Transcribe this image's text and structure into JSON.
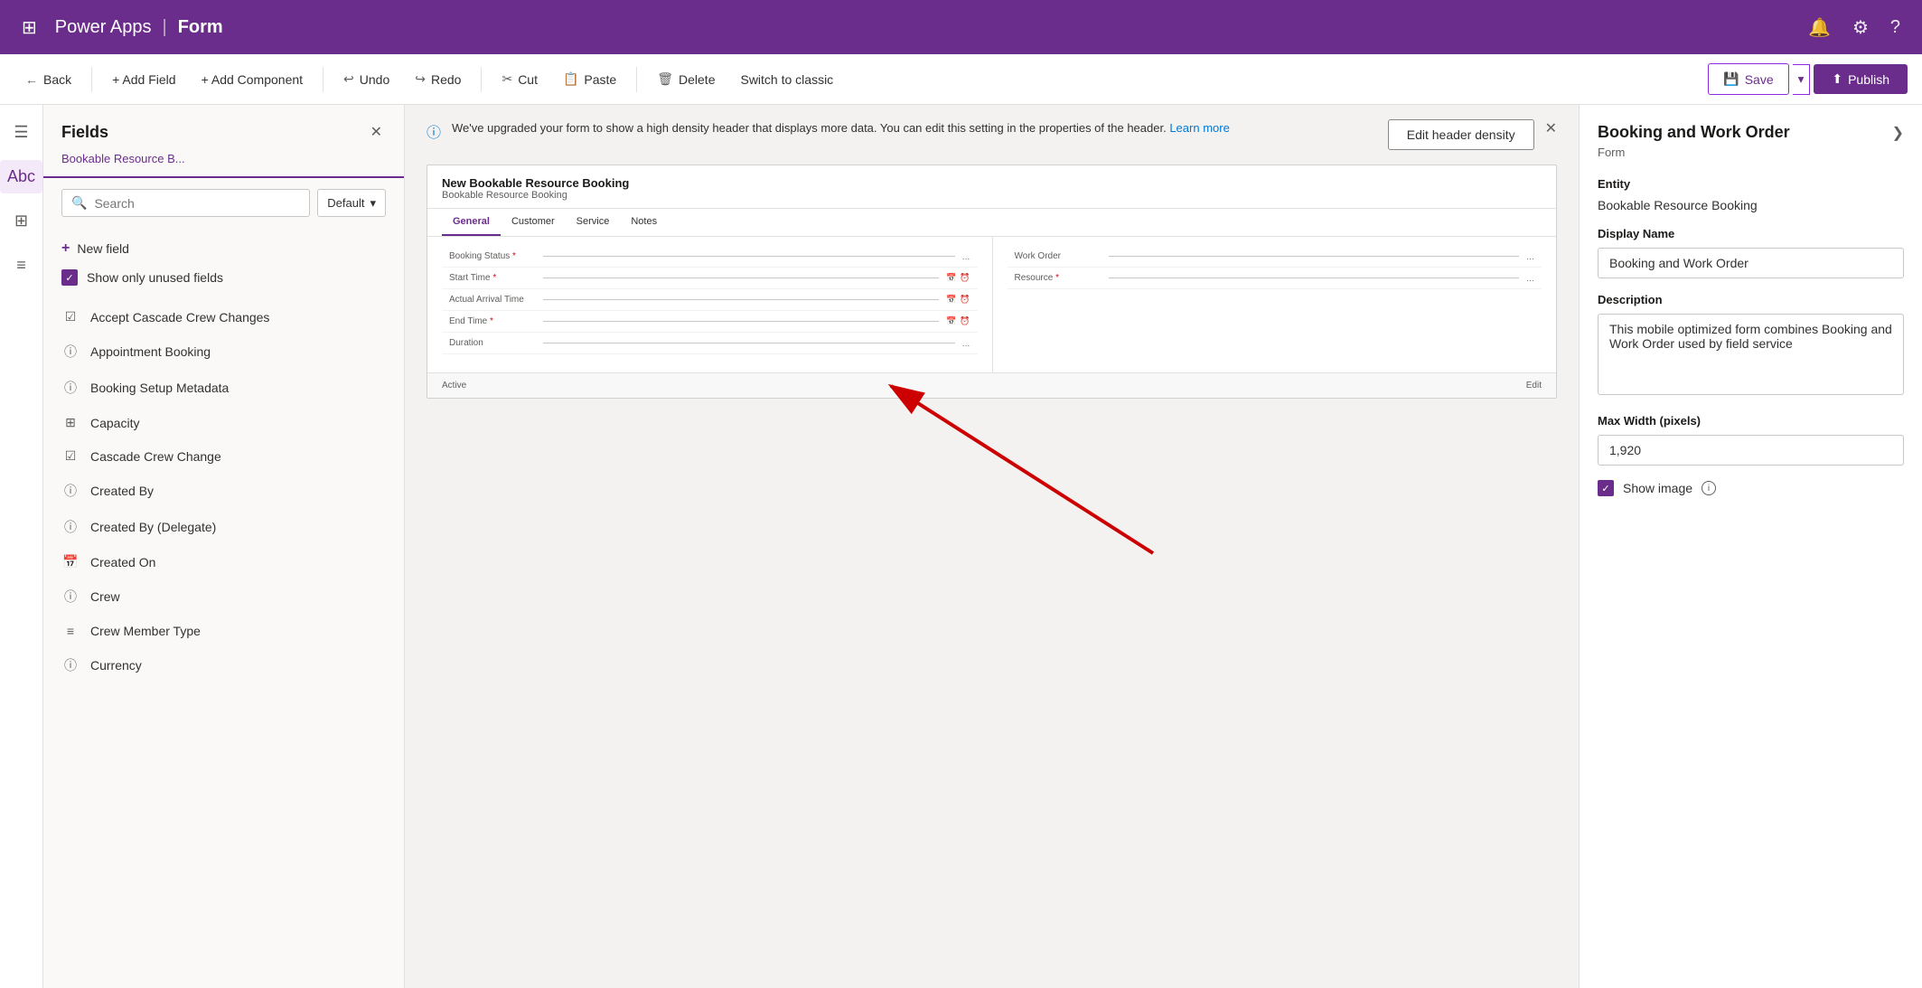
{
  "topNav": {
    "appsIcon": "⊞",
    "brand": "Power Apps",
    "sep": "|",
    "pageName": "Form",
    "bellIcon": "🔔",
    "gearIcon": "⚙",
    "helpIcon": "?"
  },
  "toolbar": {
    "backLabel": "Back",
    "addFieldLabel": "+ Add Field",
    "addComponentLabel": "+ Add Component",
    "undoLabel": "Undo",
    "redoLabel": "Redo",
    "cutLabel": "Cut",
    "pasteLabel": "Paste",
    "deleteLabel": "Delete",
    "switchClassicLabel": "Switch to classic",
    "saveLabel": "Save",
    "publishLabel": "Publish"
  },
  "infoBanner": {
    "text": "We've upgraded your form to show a high density header that displays more data. You can edit this setting in the properties of the header.",
    "learnMore": "Learn more",
    "editHeaderBtn": "Edit header density"
  },
  "fieldsPanel": {
    "title": "Fields",
    "entityLabel": "Bookable Resource B...",
    "searchPlaceholder": "Search",
    "dropdownLabel": "Default",
    "newFieldLabel": "New field",
    "showUnusedLabel": "Show only unused fields",
    "items": [
      {
        "name": "Accept Cascade Crew Changes",
        "iconType": "checkbox"
      },
      {
        "name": "Appointment Booking",
        "iconType": "info-circle"
      },
      {
        "name": "Booking Setup Metadata",
        "iconType": "info-circle"
      },
      {
        "name": "Capacity",
        "iconType": "grid-3x3"
      },
      {
        "name": "Cascade Crew Change",
        "iconType": "checkbox"
      },
      {
        "name": "Created By",
        "iconType": "info-circle"
      },
      {
        "name": "Created By (Delegate)",
        "iconType": "info-circle"
      },
      {
        "name": "Created On",
        "iconType": "calendar"
      },
      {
        "name": "Crew",
        "iconType": "info-circle"
      },
      {
        "name": "Crew Member Type",
        "iconType": "dropdown"
      },
      {
        "name": "Currency",
        "iconType": "info-circle"
      }
    ]
  },
  "formPreview": {
    "title": "New Bookable Resource Booking",
    "subtitle": "Bookable Resource Booking",
    "tabs": [
      "General",
      "Customer",
      "Service",
      "Notes"
    ],
    "activeTab": "General",
    "leftFields": [
      {
        "label": "Booking Status",
        "required": true
      },
      {
        "label": "Start Time",
        "required": true,
        "hasCalendar": true,
        "hasClock": true
      },
      {
        "label": "Actual Arrival Time",
        "required": false,
        "hasCalendar": true,
        "hasClock": true
      },
      {
        "label": "End Time",
        "required": true,
        "hasCalendar": true,
        "hasClock": true
      },
      {
        "label": "Duration",
        "required": false
      }
    ],
    "rightFields": [
      {
        "label": "Work Order",
        "required": false
      },
      {
        "label": "Resource",
        "required": true
      }
    ],
    "footer": {
      "leftLabel": "Active",
      "rightLabel": "Edit"
    }
  },
  "rightPanel": {
    "title": "Booking and Work Order",
    "subtitle": "Form",
    "entityLabel": "Entity",
    "entityValue": "Bookable Resource Booking",
    "displayNameLabel": "Display Name",
    "displayNameValue": "Booking and Work Order",
    "descriptionLabel": "Description",
    "descriptionValue": "This mobile optimized form combines Booking and Work Order used by field service",
    "maxWidthLabel": "Max Width (pixels)",
    "maxWidthValue": "1,920",
    "showImageLabel": "Show image",
    "chevronIcon": "❯"
  }
}
